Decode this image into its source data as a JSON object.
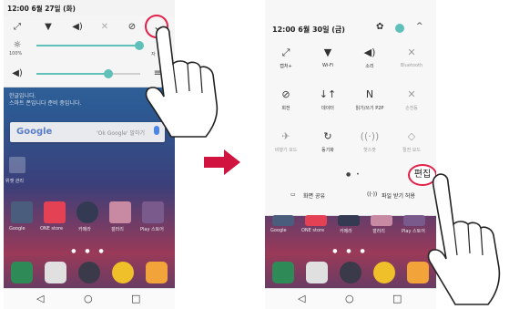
{
  "left_phone": {
    "time": "12:00 6월 27일 (화)",
    "quick_icons": [
      "expand-icon",
      "wifi-icon",
      "sound-icon",
      "bluetooth-off-icon",
      "dnd-icon",
      "expand-down-icon"
    ],
    "brightness_label": "100%",
    "auto_label": "자",
    "bg_note_1": "한글입니다.",
    "bg_note_2": "스마트 폰입니다 준비 중입니다.",
    "search_logo": "Google",
    "search_placeholder": "'Ok Google' 말하기",
    "folder_label": "위젯 관리",
    "apps": [
      {
        "label": "Google"
      },
      {
        "label": "ONE store"
      },
      {
        "label": "카메라"
      },
      {
        "label": "갤러리"
      },
      {
        "label": "Play 스토어"
      }
    ],
    "nav": {
      "back": "◁",
      "home": "○",
      "recent": "□"
    }
  },
  "right_phone": {
    "header_date": "12:00 6월 30일 (금)",
    "tiles": [
      {
        "icon": "⤢",
        "label": "캡처+",
        "dim": false
      },
      {
        "icon": "▼",
        "label": "Wi-Fi",
        "dim": false
      },
      {
        "icon": "◀)",
        "label": "소리",
        "dim": false
      },
      {
        "icon": "✕",
        "label": "Bluetooth",
        "dim": true
      },
      {
        "icon": "⊘",
        "label": "회전",
        "dim": false
      },
      {
        "icon": "↓↑",
        "label": "데이터",
        "dim": false
      },
      {
        "icon": "N",
        "label": "읽기/쓰기 P2P",
        "dim": false
      },
      {
        "icon": "✕",
        "label": "손전등",
        "dim": true
      },
      {
        "icon": "✈",
        "label": "비행기 모드",
        "dim": true
      },
      {
        "icon": "↻",
        "label": "동기화",
        "dim": false
      },
      {
        "icon": "((·))",
        "label": "핫스팟",
        "dim": true
      },
      {
        "icon": "◇",
        "label": "절전 모드",
        "dim": true
      }
    ],
    "edit_label": "편집",
    "share_screen": "화면 공유",
    "file_receive": "파일 받기 허용",
    "apps": [
      {
        "label": "Google"
      },
      {
        "label": "ONE store"
      },
      {
        "label": "카메라"
      },
      {
        "label": "갤러리"
      },
      {
        "label": "Play 스토어"
      }
    ],
    "nav": {
      "back": "◁",
      "home": "○",
      "recent": "□"
    }
  },
  "colors": {
    "accent_teal": "#5ec0b8",
    "highlight_red": "#e2214b",
    "arrow_red": "#d1143f"
  }
}
